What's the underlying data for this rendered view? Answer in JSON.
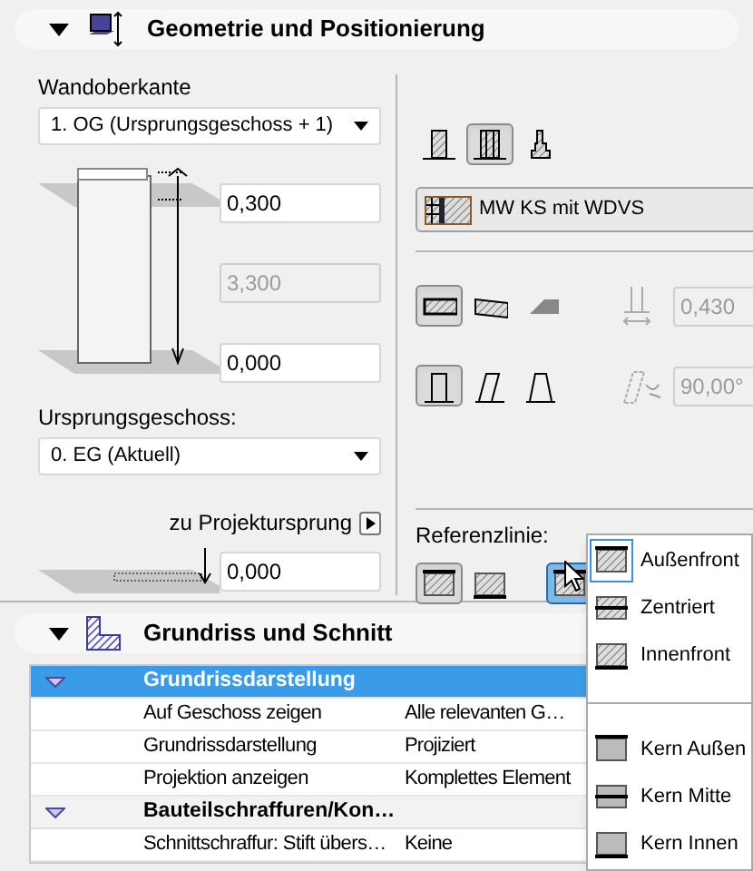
{
  "geometry": {
    "title": "Geometrie und Positionierung",
    "expanded": true,
    "top_label": "Wandoberkante",
    "top_select": "1. OG (Ursprungsgeschoss + 1)",
    "fields": [
      {
        "value": "0,300",
        "disabled": false
      },
      {
        "value": "3,300",
        "disabled": true
      },
      {
        "value": "0,000",
        "disabled": false
      }
    ],
    "home_label": "Ursprungsgeschoss:",
    "home_select": "0. EG (Aktuell)",
    "origin_link": "zu Projektursprung",
    "origin_field": {
      "value": "0,000",
      "disabled": false
    },
    "structure_buttons": [
      {
        "kind": "basic",
        "selected": false
      },
      {
        "kind": "composite",
        "selected": true
      },
      {
        "kind": "profile",
        "selected": false
      }
    ],
    "composite": "MW KS mit WDVS",
    "end_buttons": [
      {
        "kind": "straight",
        "selected": true
      },
      {
        "kind": "trapezoid",
        "selected": false
      },
      {
        "kind": "polygon",
        "selected": false
      }
    ],
    "thickness": {
      "value": "0,430",
      "disabled": true
    },
    "slant_buttons": [
      {
        "kind": "straight",
        "selected": true
      },
      {
        "kind": "slanted",
        "selected": false
      },
      {
        "kind": "double",
        "selected": false
      }
    ],
    "angle": {
      "value": "90,00°",
      "disabled": true
    },
    "reference": {
      "label": "Referenzlinie:",
      "buttons": [
        {
          "kind": "outside",
          "selected": true
        },
        {
          "kind": "inside",
          "selected": false
        },
        {
          "kind": "menu",
          "open": true
        }
      ],
      "menu": [
        {
          "kind": "outside",
          "label": "Außenfront",
          "selected": true
        },
        {
          "kind": "center",
          "label": "Zentriert",
          "selected": false
        },
        {
          "kind": "inside",
          "label": "Innenfront",
          "selected": false
        },
        {
          "kind": "separator"
        },
        {
          "kind": "core_outside",
          "label": "Kern Außen",
          "selected": false
        },
        {
          "kind": "core_center",
          "label": "Kern Mitte",
          "selected": false
        },
        {
          "kind": "core_inside",
          "label": "Kern Innen",
          "selected": false
        }
      ]
    }
  },
  "plan_section": {
    "title": "Grundriss und Schnitt",
    "expanded": true,
    "rows": [
      {
        "kind": "group",
        "label": "Grundrissdarstellung",
        "expanded": true,
        "selected": true
      },
      {
        "kind": "param",
        "label": "Auf Geschoss zeigen",
        "value": "Alle relevanten G…"
      },
      {
        "kind": "param",
        "label": "Grundrissdarstellung",
        "value": "Projiziert"
      },
      {
        "kind": "param",
        "label": "Projektion anzeigen",
        "value": "Komplettes Element"
      },
      {
        "kind": "group",
        "label": "Bauteilschraffuren/Kon…",
        "expanded": true,
        "selected": false
      },
      {
        "kind": "param",
        "label": "Schnittschraffur: Stift übers…",
        "value": "Keine"
      }
    ]
  }
}
